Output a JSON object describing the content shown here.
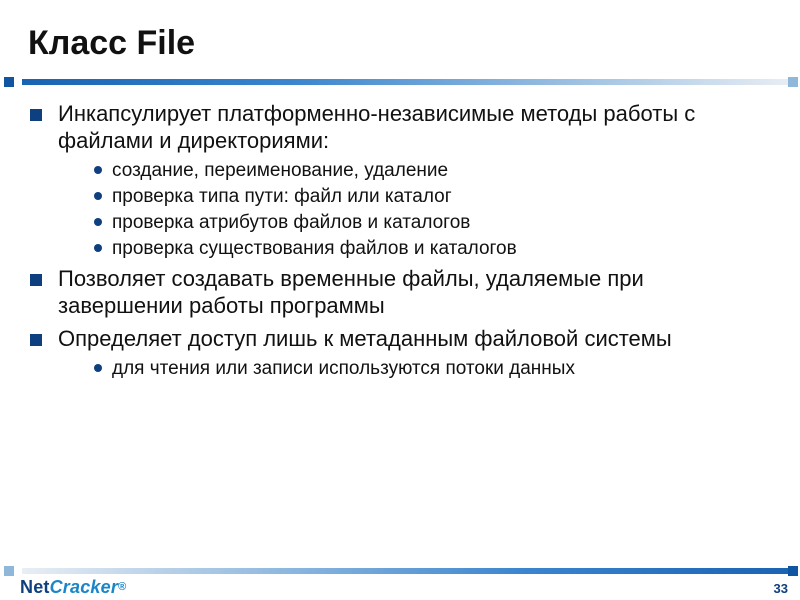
{
  "title": "Класс File",
  "bullets": [
    {
      "text": "Инкапсулирует платформенно-независимые методы работы с файлами и директориями:",
      "children": [
        "создание, переименование, удаление",
        "проверка типа пути: файл или каталог",
        "проверка атрибутов файлов и каталогов",
        "проверка существования файлов и каталогов"
      ]
    },
    {
      "text": "Позволяет  создавать временные файлы, удаляемые при завершении работы программы",
      "children": []
    },
    {
      "text": "Определяет доступ лишь к метаданным файловой системы",
      "children": [
        "для чтения или записи используются потоки данных"
      ]
    }
  ],
  "logo": {
    "part1": "Net",
    "part2": "Cracker"
  },
  "page_number": "33"
}
